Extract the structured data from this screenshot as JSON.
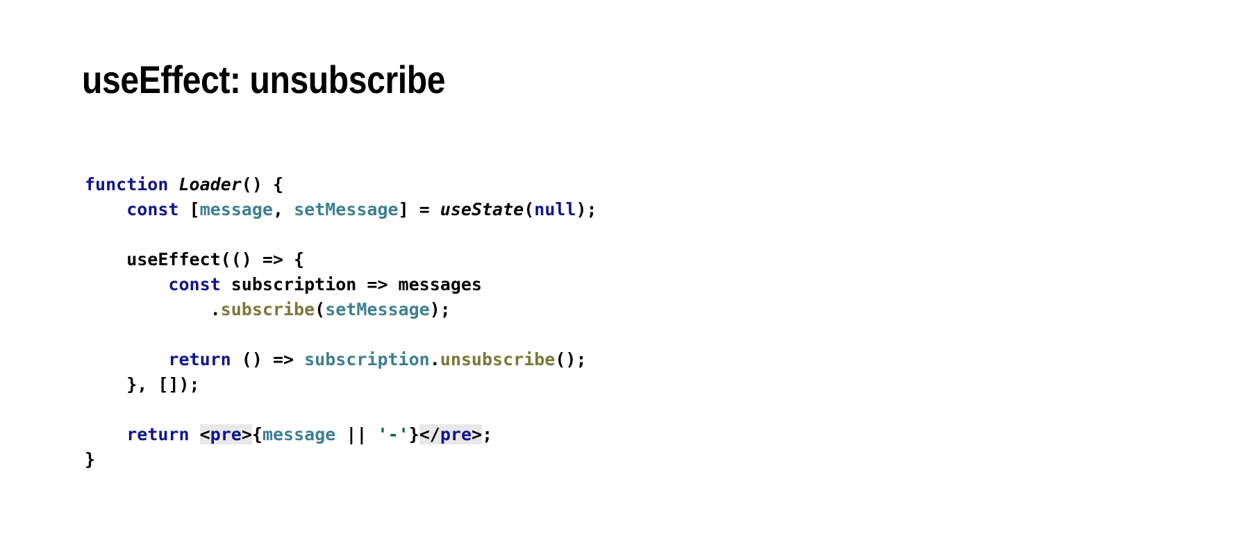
{
  "slide": {
    "title": "useEffect: unsubscribe",
    "background_color": "#ffffff",
    "title_color": "#000000"
  },
  "theme": {
    "keyword_color": "#10148c",
    "plain_color": "#000000",
    "definition_color": "#000000",
    "variable_color": "#3d7f8f",
    "function_color": "#7d7637",
    "string_color": "#0b6b22",
    "highlight_background": "#e8e8e8"
  },
  "code": {
    "language": "javascript",
    "full_text": "function Loader() {\n    const [message, setMessage] = useState(null);\n\n    useEffect(() => {\n        const subscription => messages\n            .subscribe(setMessage);\n\n        return () => subscription.unsubscribe();\n    }, []);\n\n    return <pre>{message || '-'}</pre>;\n}",
    "lines": [
      {
        "id": "line-1",
        "tokens": [
          {
            "text": "function",
            "style": "kw"
          },
          {
            "text": " ",
            "style": "plain"
          },
          {
            "text": "Loader",
            "style": "name"
          },
          {
            "text": "() {",
            "style": "plain"
          }
        ]
      },
      {
        "id": "line-2",
        "tokens": [
          {
            "text": "    ",
            "style": "plain"
          },
          {
            "text": "const",
            "style": "kw"
          },
          {
            "text": " [",
            "style": "plain"
          },
          {
            "text": "message",
            "style": "var"
          },
          {
            "text": ", ",
            "style": "plain"
          },
          {
            "text": "setMessage",
            "style": "var"
          },
          {
            "text": "] = ",
            "style": "plain"
          },
          {
            "text": "useState",
            "style": "name"
          },
          {
            "text": "(",
            "style": "plain"
          },
          {
            "text": "null",
            "style": "kw"
          },
          {
            "text": ");",
            "style": "plain"
          }
        ]
      },
      {
        "id": "line-3",
        "tokens": [
          {
            "text": " ",
            "style": "plain"
          }
        ]
      },
      {
        "id": "line-4",
        "tokens": [
          {
            "text": "    useEffect(() => {",
            "style": "plain"
          }
        ]
      },
      {
        "id": "line-5",
        "tokens": [
          {
            "text": "        ",
            "style": "plain"
          },
          {
            "text": "const",
            "style": "kw"
          },
          {
            "text": " subscription => messages",
            "style": "plain"
          }
        ]
      },
      {
        "id": "line-6",
        "tokens": [
          {
            "text": "            .",
            "style": "plain"
          },
          {
            "text": "subscribe",
            "style": "fn"
          },
          {
            "text": "(",
            "style": "plain"
          },
          {
            "text": "setMessage",
            "style": "var"
          },
          {
            "text": ");",
            "style": "plain"
          }
        ]
      },
      {
        "id": "line-7",
        "tokens": [
          {
            "text": " ",
            "style": "plain"
          }
        ]
      },
      {
        "id": "line-8",
        "tokens": [
          {
            "text": "        ",
            "style": "plain"
          },
          {
            "text": "return",
            "style": "kw"
          },
          {
            "text": " () => ",
            "style": "plain"
          },
          {
            "text": "subscription",
            "style": "var"
          },
          {
            "text": ".",
            "style": "plain"
          },
          {
            "text": "unsubscribe",
            "style": "fn"
          },
          {
            "text": "();",
            "style": "plain"
          }
        ]
      },
      {
        "id": "line-9",
        "tokens": [
          {
            "text": "    }, []);",
            "style": "plain"
          }
        ]
      },
      {
        "id": "line-10",
        "tokens": [
          {
            "text": " ",
            "style": "plain"
          }
        ]
      },
      {
        "id": "line-11",
        "tokens": [
          {
            "text": "    ",
            "style": "plain"
          },
          {
            "text": "return",
            "style": "kw"
          },
          {
            "text": " ",
            "style": "plain"
          },
          {
            "text": "<",
            "style": "punct-hl"
          },
          {
            "text": "pre",
            "style": "tag"
          },
          {
            "text": ">",
            "style": "punct-hl"
          },
          {
            "text": "{",
            "style": "plain"
          },
          {
            "text": "message",
            "style": "var"
          },
          {
            "text": " || ",
            "style": "plain"
          },
          {
            "text": "'-'",
            "style": "str"
          },
          {
            "text": "}",
            "style": "plain"
          },
          {
            "text": "</",
            "style": "punct-hl"
          },
          {
            "text": "pre",
            "style": "tag"
          },
          {
            "text": ">",
            "style": "punct-hl"
          },
          {
            "text": ";",
            "style": "plain"
          }
        ]
      },
      {
        "id": "line-12",
        "tokens": [
          {
            "text": "}",
            "style": "plain"
          }
        ]
      }
    ]
  }
}
